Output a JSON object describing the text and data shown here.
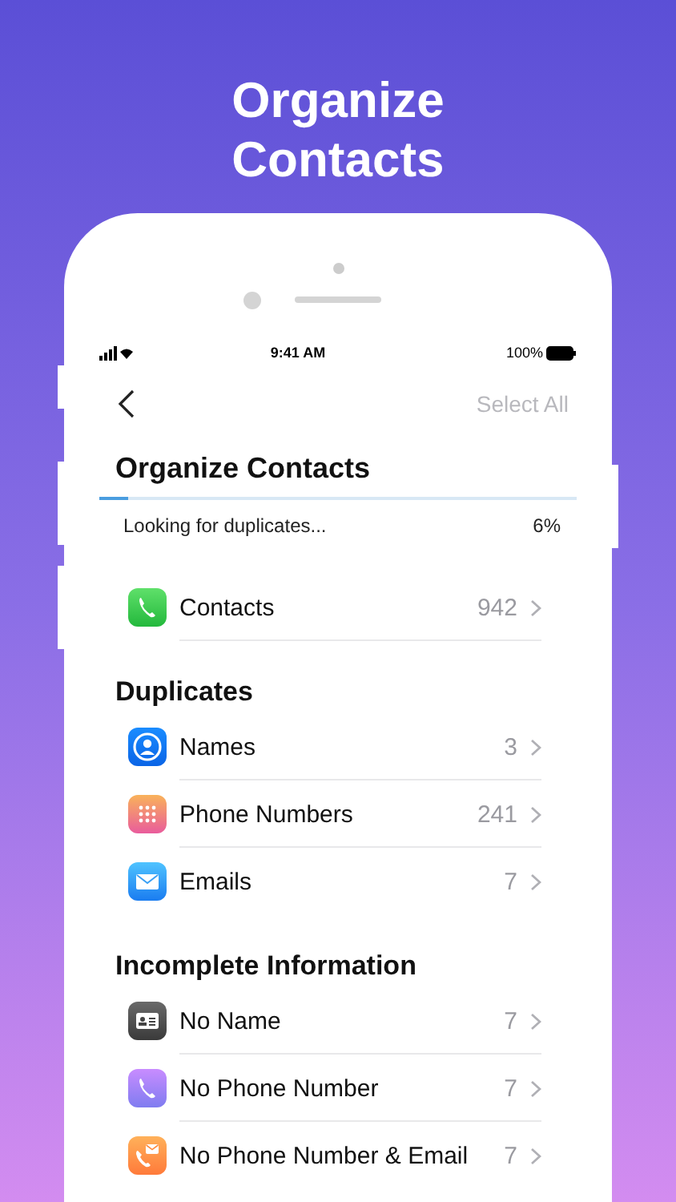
{
  "headline": "Organize Contacts",
  "status_bar": {
    "time": "9:41 AM",
    "battery": "100%"
  },
  "nav": {
    "action": "Select All"
  },
  "title": "Organize Contacts",
  "progress": {
    "label": "Looking for duplicates...",
    "reading": "6%",
    "level": 0.06
  },
  "summary": [
    {
      "kind": "phone",
      "label": "Contacts",
      "count": "942"
    }
  ],
  "sections": [
    {
      "title": "Duplicates",
      "rows": [
        {
          "kind": "person",
          "label": "Names",
          "count": "3"
        },
        {
          "kind": "keypad",
          "label": "Phone Numbers",
          "count": "241"
        },
        {
          "kind": "mail",
          "label": "Emails",
          "count": "7"
        }
      ]
    },
    {
      "title": "Incomplete Information",
      "rows": [
        {
          "kind": "card",
          "label": "No Name",
          "count": "7"
        },
        {
          "kind": "phone-purple",
          "label": "No Phone Number",
          "count": "7"
        },
        {
          "kind": "phone-mail",
          "label": "No Phone Number & Email",
          "count": "7"
        }
      ]
    }
  ]
}
